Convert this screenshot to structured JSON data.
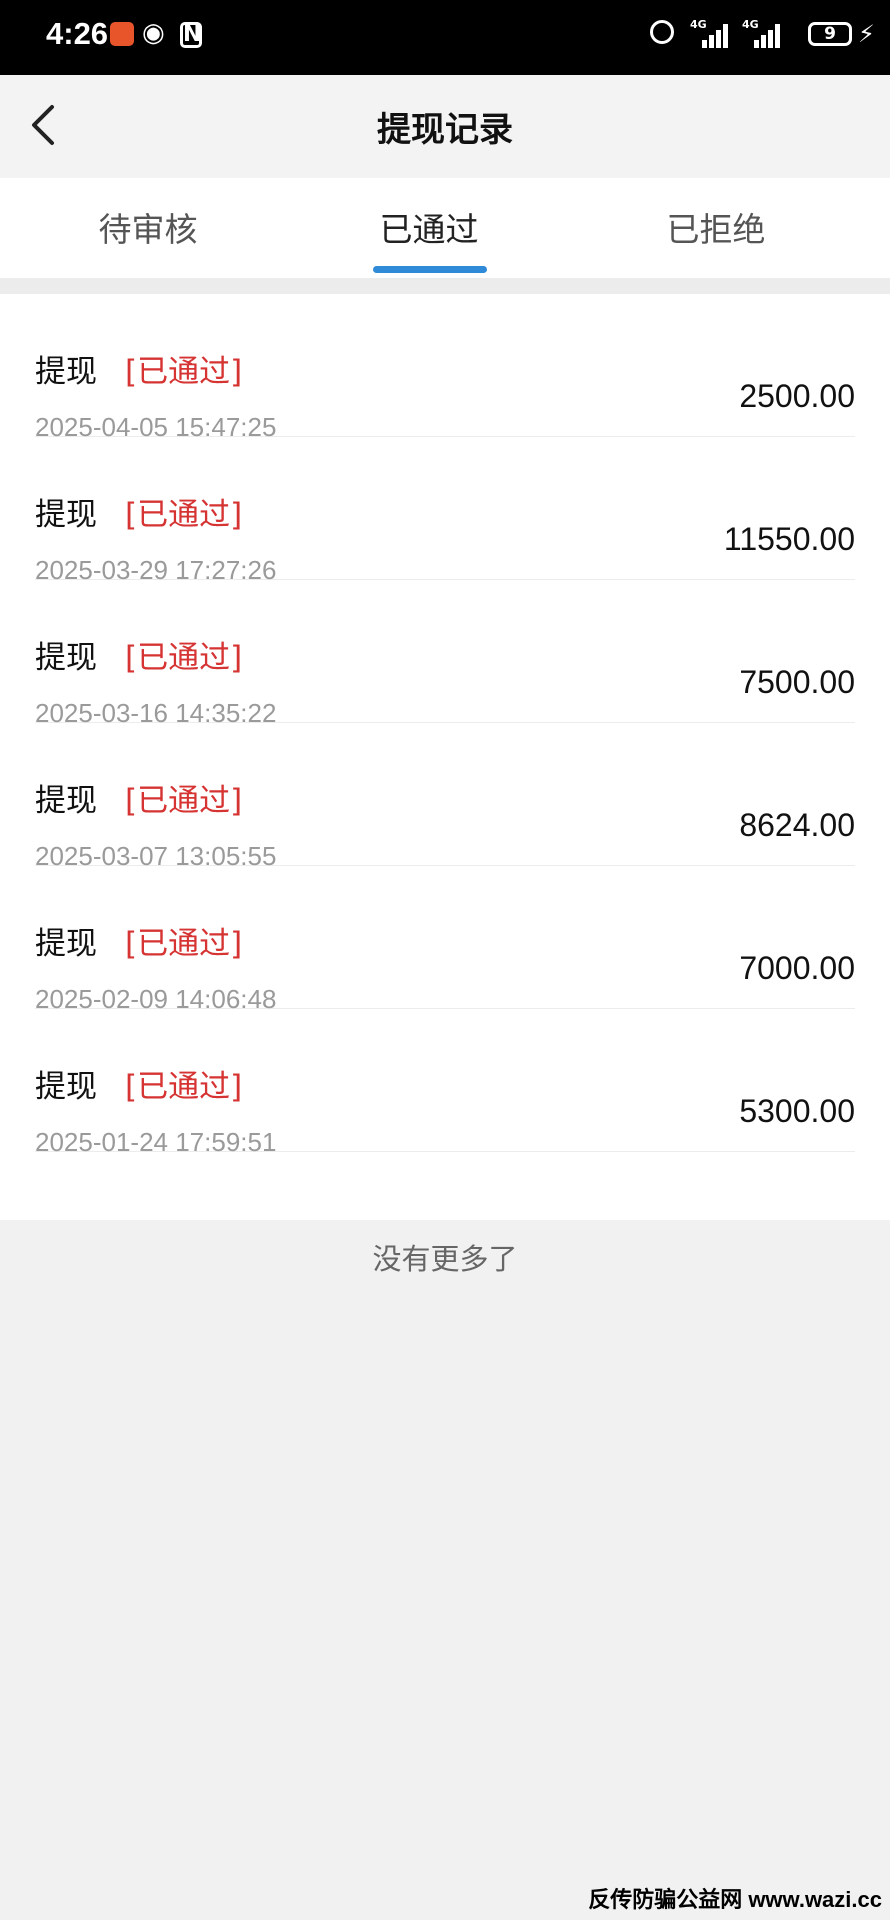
{
  "status_bar": {
    "time": "4:26",
    "signal_label": "4G",
    "battery": "9",
    "icons": [
      "app-icon",
      "eye-icon",
      "nfc-icon",
      "alarm-icon",
      "signal-icon",
      "signal-icon",
      "battery-icon",
      "charging-icon"
    ]
  },
  "header": {
    "title": "提现记录",
    "back_icon": "chevron-left-icon"
  },
  "tabs": [
    {
      "label": "待审核"
    },
    {
      "label": "已通过",
      "active": true
    },
    {
      "label": "已拒绝"
    }
  ],
  "colors": {
    "accent": "#2f8bd8",
    "status": "#d63333"
  },
  "records": [
    {
      "type": "提现",
      "status": "[已通过]",
      "date": "2025-04-05 15:47:25",
      "amount": "2500.00"
    },
    {
      "type": "提现",
      "status": "[已通过]",
      "date": "2025-03-29 17:27:26",
      "amount": "11550.00"
    },
    {
      "type": "提现",
      "status": "[已通过]",
      "date": "2025-03-16 14:35:22",
      "amount": "7500.00"
    },
    {
      "type": "提现",
      "status": "[已通过]",
      "date": "2025-03-07 13:05:55",
      "amount": "8624.00"
    },
    {
      "type": "提现",
      "status": "[已通过]",
      "date": "2025-02-09 14:06:48",
      "amount": "7000.00"
    },
    {
      "type": "提现",
      "status": "[已通过]",
      "date": "2025-01-24 17:59:51",
      "amount": "5300.00"
    }
  ],
  "footer": {
    "no_more": "没有更多了"
  },
  "watermark": "反传防骗公益网 www.wazi.cc"
}
